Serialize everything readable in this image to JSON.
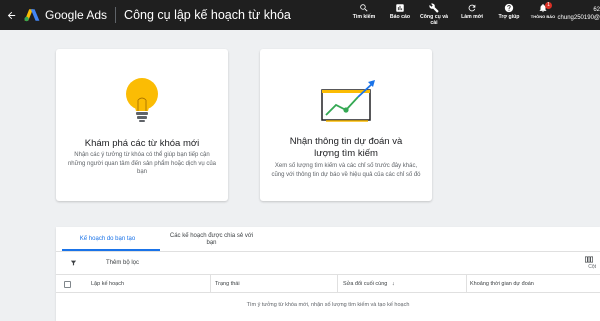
{
  "header": {
    "back_icon": "arrow-back-icon",
    "logo_text": "Google Ads",
    "title": "Công cụ lập kế hoạch từ khóa",
    "actions": [
      {
        "label": "Tìm kiếm",
        "icon": "search-icon"
      },
      {
        "label": "Báo cáo",
        "icon": "report-icon"
      },
      {
        "label": "Công cụ và cài",
        "icon": "tools-icon"
      },
      {
        "label": "Làm mới",
        "icon": "refresh-icon"
      },
      {
        "label": "Trợ giúp",
        "icon": "help-icon"
      },
      {
        "label": "THÔNG BÁO",
        "icon": "bell-icon",
        "badge": "1"
      }
    ],
    "account_top": "62",
    "account_email": "chung250190@"
  },
  "cards": [
    {
      "icon": "lightbulb-icon",
      "title": "Khám phá các từ khóa mới",
      "description": "Nhận các ý tưởng từ khóa có thể giúp bạn tiếp cận những người quan tâm đến sản phẩm hoặc dịch vụ của bạn"
    },
    {
      "icon": "forecast-chart-icon",
      "title_line1": "Nhận thông tin dự đoán và",
      "title_line2": "lượng tìm kiếm",
      "description": "Xem số lượng tìm kiếm và các chỉ số trước đây khác, cũng với thông tin dự báo về hiệu quả của các chỉ số đó"
    }
  ],
  "plans": {
    "tab_created": "Kế hoạch do bạn tạo",
    "tab_shared_line1": "Các kế hoạch được chia sẻ với",
    "tab_shared_line2": "bạn",
    "add_filter": "Thêm bộ lọc",
    "columns_label": "Cột",
    "headers": [
      "Lập kế hoạch",
      "Trạng thái",
      "Sửa đổi cuối cùng",
      "Khoảng thời gian dự đoán"
    ],
    "empty_message": "Tìm ý tưởng từ khóa mới, nhận số lượng tìm kiếm và tạo kế hoạch"
  },
  "colors": {
    "topbar": "#1f1f1f",
    "accent": "#1a73e8",
    "bulb": "#fbbc04",
    "chart_line": "#34a853"
  }
}
